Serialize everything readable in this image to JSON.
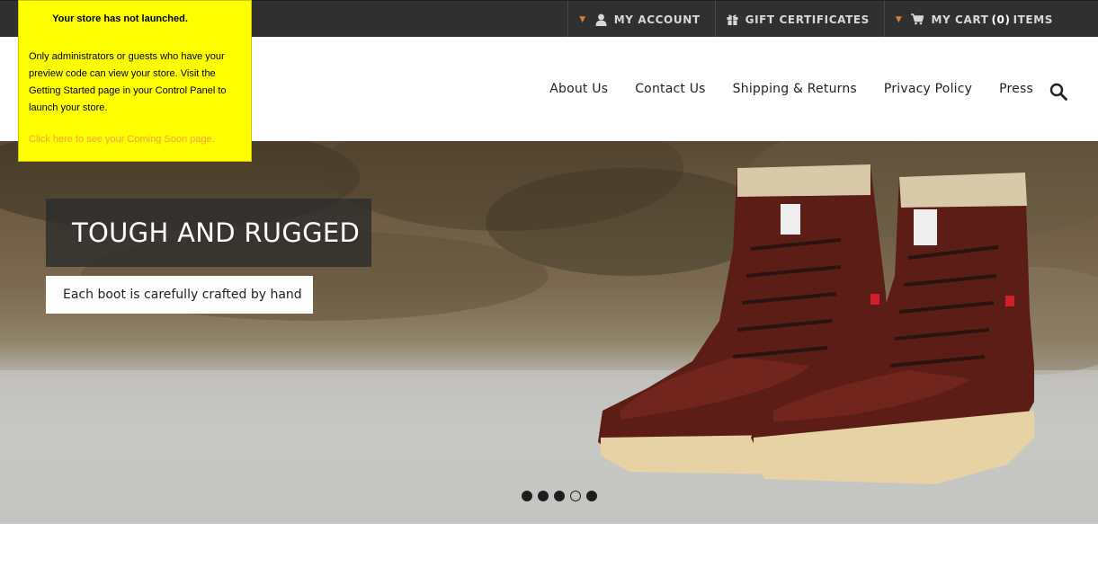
{
  "topbar": {
    "account_label": "My Account",
    "gift_label": "Gift Certificates",
    "cart_prefix": "My Cart",
    "cart_count": "(0)",
    "cart_suffix": "Items",
    "accent_color": "#d87c3a"
  },
  "mainnav": {
    "items": [
      "About Us",
      "Contact Us",
      "Shipping & Returns",
      "Privacy Policy",
      "Press"
    ]
  },
  "notice": {
    "title": "Your store has not launched.",
    "body": "Only administrators or guests who have your preview code can view your store. Visit the Getting Started page in your Control Panel to launch your store.",
    "link": "Click here to see your Coming Soon page.",
    "background": "#ffff00",
    "link_color": "#f3a23a"
  },
  "hero": {
    "title": "TOUGH AND RUGGED",
    "subtitle": "Each boot is carefully crafted by hand",
    "slides_total": 5,
    "active_slide": 4
  },
  "icons": {
    "account": "user-icon",
    "gift": "gift-icon",
    "cart": "cart-icon",
    "search": "search-icon",
    "dropdown": "chevron-down-icon"
  }
}
